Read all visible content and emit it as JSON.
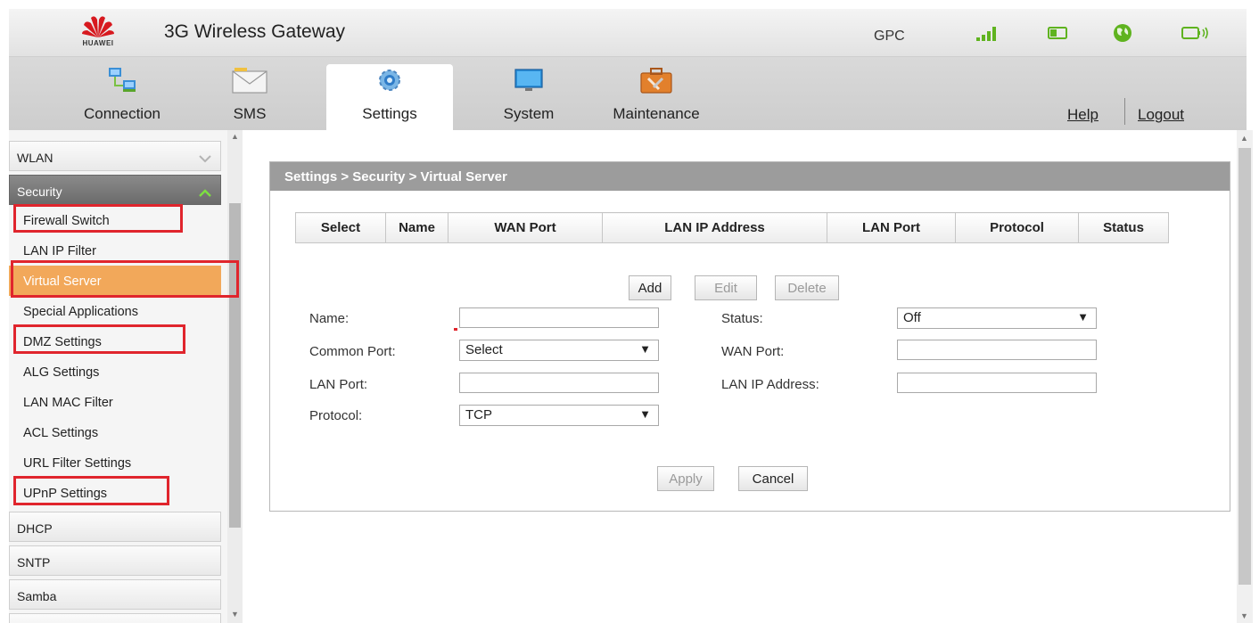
{
  "header": {
    "brand": "HUAWEI",
    "title": "3G Wireless Gateway",
    "operator": "GPC",
    "status_icons": [
      "signal-strength-icon",
      "sim-card-icon",
      "internet-globe-icon",
      "wifi-icon"
    ]
  },
  "nav": {
    "tabs": [
      {
        "label": "Connection",
        "icon": "connection-icon"
      },
      {
        "label": "SMS",
        "icon": "sms-envelope-icon"
      },
      {
        "label": "Settings",
        "icon": "settings-gear-icon",
        "active": true
      },
      {
        "label": "System",
        "icon": "system-monitor-icon"
      },
      {
        "label": "Maintenance",
        "icon": "maintenance-toolbox-icon"
      }
    ],
    "help": "Help",
    "logout": "Logout"
  },
  "sidebar": {
    "groups": [
      {
        "label": "WLAN"
      },
      {
        "label": "Security",
        "open": true
      },
      {
        "label": "DHCP"
      },
      {
        "label": "SNTP"
      },
      {
        "label": "Samba"
      }
    ],
    "security_items": [
      "Firewall Switch",
      "LAN IP Filter",
      "Virtual Server",
      "Special Applications",
      "DMZ Settings",
      "ALG Settings",
      "LAN MAC Filter",
      "ACL Settings",
      "URL Filter Settings",
      "UPnP Settings"
    ],
    "active_item": "Virtual Server"
  },
  "content": {
    "breadcrumb": "Settings > Security > Virtual Server",
    "table_headers": [
      "Select",
      "Name",
      "WAN Port",
      "LAN IP Address",
      "LAN Port",
      "Protocol",
      "Status"
    ],
    "buttons": {
      "add": "Add",
      "edit": "Edit",
      "delete": "Delete",
      "apply": "Apply",
      "cancel": "Cancel"
    },
    "form": {
      "name_label": "Name:",
      "name_value": "",
      "common_port_label": "Common Port:",
      "common_port_value": "Select",
      "lan_port_label": "LAN Port:",
      "lan_port_value": "",
      "protocol_label": "Protocol:",
      "protocol_value": "TCP",
      "status_label": "Status:",
      "status_value": "Off",
      "wan_port_label": "WAN Port:",
      "wan_port_value": "",
      "lan_ip_label": "LAN IP Address:",
      "lan_ip_value": ""
    }
  },
  "colors": {
    "active_item_bg": "#f2a85a",
    "highlight_box": "#e0252d",
    "signal_green": "#5fb31f",
    "brand_red": "#d7191f"
  }
}
